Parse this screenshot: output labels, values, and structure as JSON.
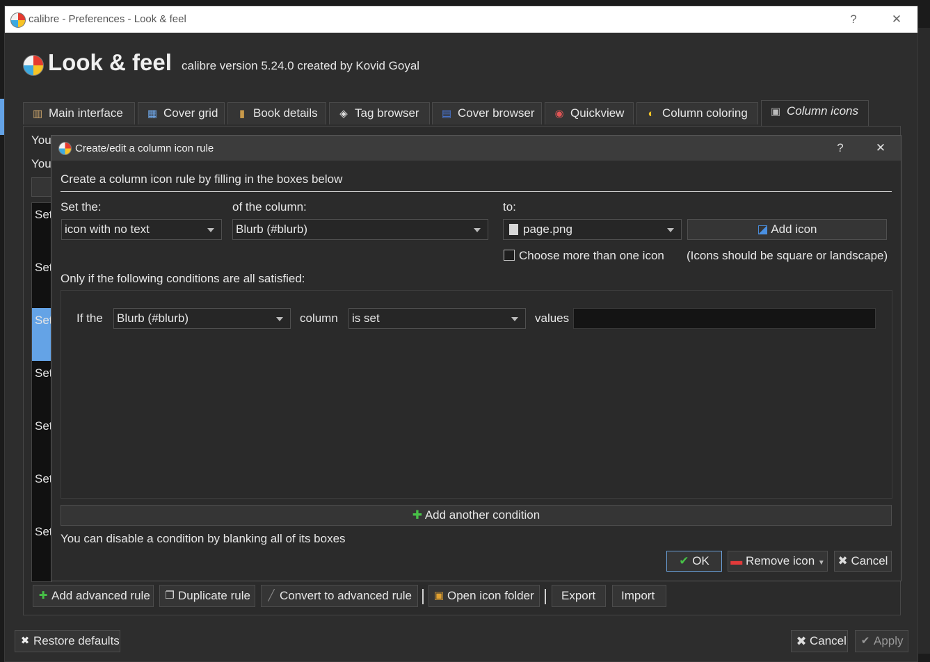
{
  "window": {
    "title": "calibre - Preferences - Look & feel",
    "help_label": "?",
    "close_label": "✕"
  },
  "header": {
    "title": "Look & feel",
    "version": "calibre version 5.24.0 created by Kovid Goyal"
  },
  "tabs": [
    {
      "label": "Main interface",
      "icon": "books-icon"
    },
    {
      "label": "Cover grid",
      "icon": "grid-icon"
    },
    {
      "label": "Book details",
      "icon": "book-icon"
    },
    {
      "label": "Tag browser",
      "icon": "tag-icon"
    },
    {
      "label": "Cover browser",
      "icon": "cover-browser-icon"
    },
    {
      "label": "Quickview",
      "icon": "eye-icon"
    },
    {
      "label": "Column coloring",
      "icon": "palette-icon"
    },
    {
      "label": "Column icons",
      "icon": "column-icons-icon",
      "active": true
    }
  ],
  "background_panel": {
    "intro_lines": [
      "You",
      "You"
    ],
    "list_items": [
      "Set",
      "Set",
      "Set",
      "Set",
      "Set",
      "Set",
      "Set"
    ],
    "bottom_buttons": [
      "Add advanced rule",
      "Duplicate rule",
      "Convert to advanced rule",
      "Open icon folder",
      "Export",
      "Import"
    ]
  },
  "footer": {
    "restore_defaults": "Restore defaults",
    "cancel": "Cancel",
    "apply": "Apply"
  },
  "dialog": {
    "title": "Create/edit a column icon rule",
    "help_label": "?",
    "close_label": "✕",
    "instruction": "Create a column icon rule by filling in the boxes below",
    "set_the_label": "Set the:",
    "set_the_value": "icon with no text",
    "of_column_label": "of the column:",
    "of_column_value": "Blurb (#blurb)",
    "to_label": "to:",
    "to_value": "page.png",
    "add_icon": "Add icon",
    "choose_more_label": "Choose more than one icon",
    "icons_hint": "(Icons should be square or landscape)",
    "conditions_label": "Only if the following conditions are all satisfied:",
    "condition": {
      "if_the": "If the",
      "column_value": "Blurb (#blurb)",
      "column_word": "column",
      "operator": "is set",
      "values_label": "values",
      "values_value": ""
    },
    "add_condition": "Add another condition",
    "disable_hint": "You can disable a condition by blanking all of its boxes",
    "ok": "OK",
    "remove_icon": "Remove icon",
    "cancel": "Cancel"
  },
  "colors": {
    "accent_blue": "#64a3e6",
    "plus_green": "#47c047"
  }
}
